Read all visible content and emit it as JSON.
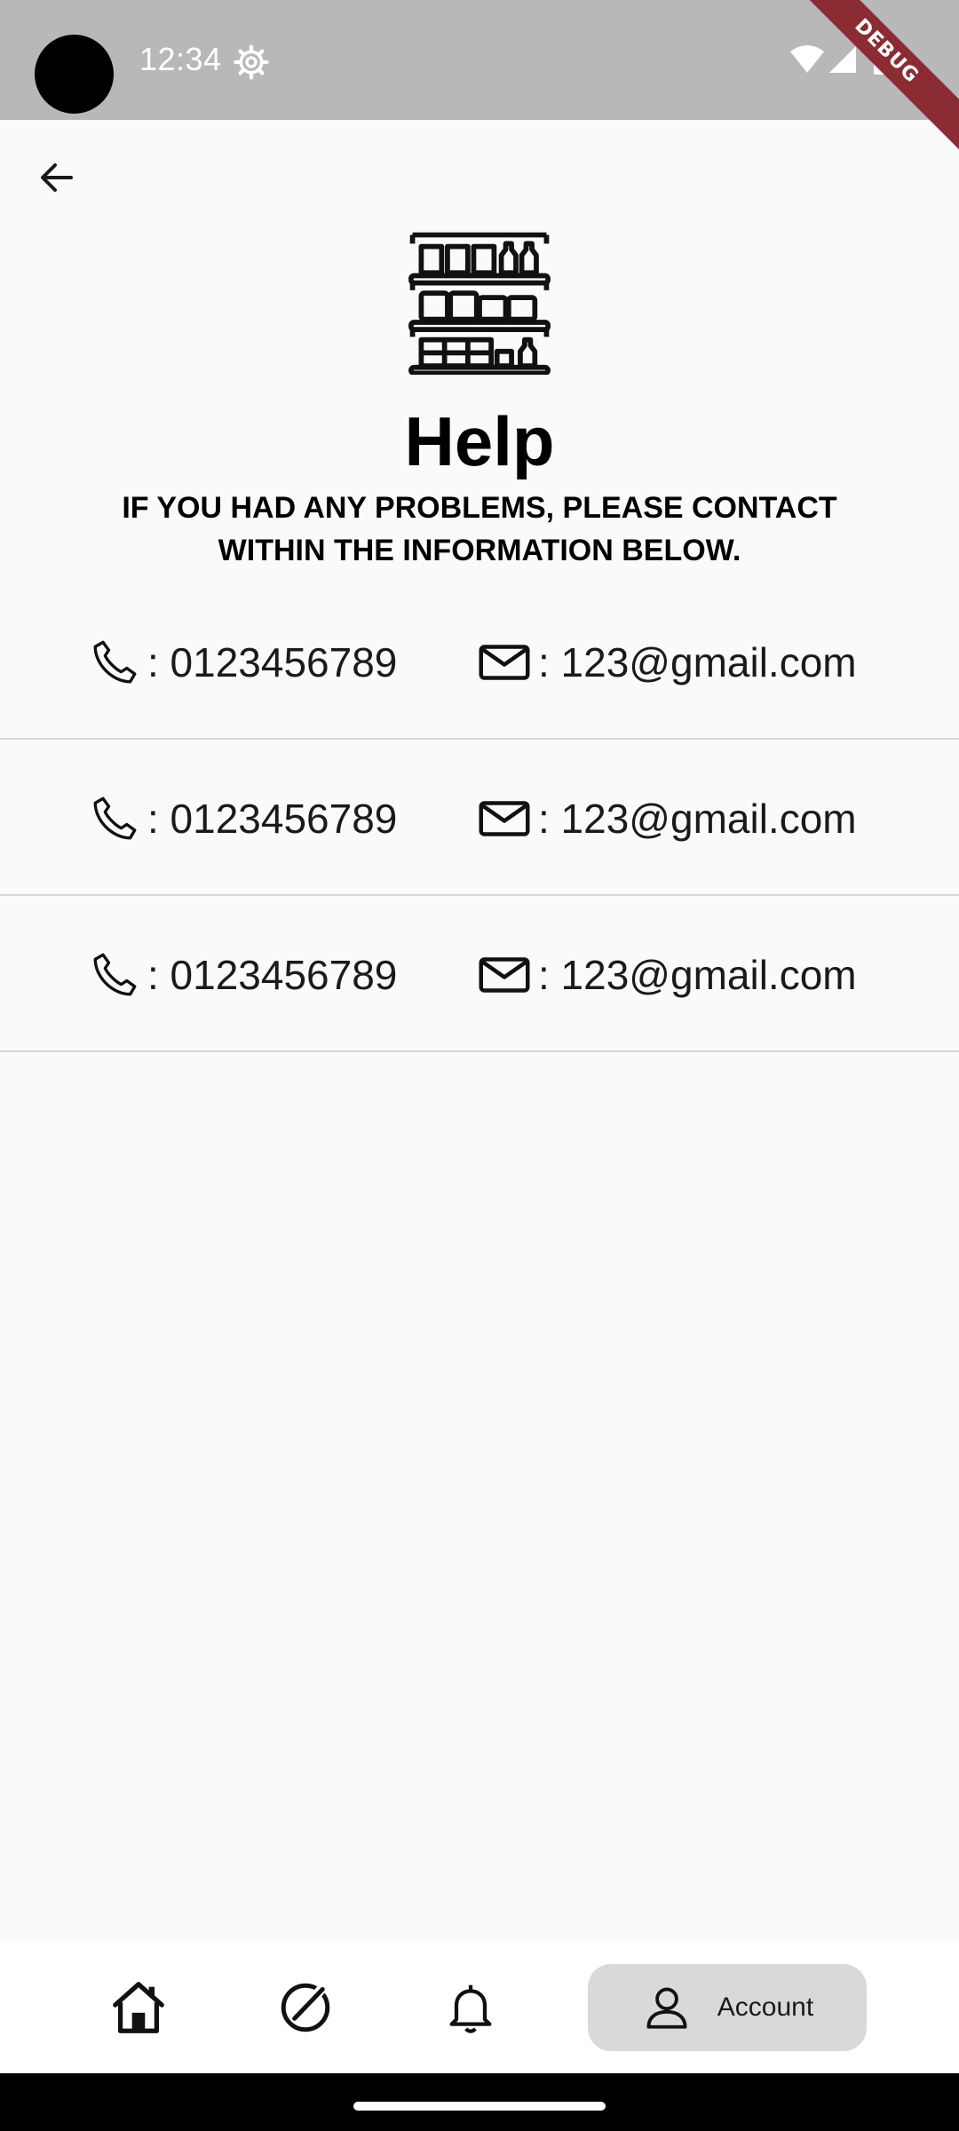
{
  "status_bar": {
    "time": "12:34",
    "debug_label": "DEBUG",
    "icons": [
      "settings-icon",
      "wifi-icon",
      "signal-icon",
      "battery-icon"
    ]
  },
  "header": {
    "back_icon": "arrow-back-icon",
    "logo_icon": "store-shelves-icon",
    "title": "Help",
    "subtitle": "IF YOU HAD ANY PROBLEMS, PLEASE CONTACT WITHIN THE INFORMATION BELOW."
  },
  "contacts": [
    {
      "phone": ": 0123456789",
      "email": ": 123@gmail.com"
    },
    {
      "phone": ": 0123456789",
      "email": ": 123@gmail.com"
    },
    {
      "phone": ": 0123456789",
      "email": ": 123@gmail.com"
    }
  ],
  "bottom_nav": {
    "items": [
      {
        "icon": "home-icon"
      },
      {
        "icon": "explore-icon"
      },
      {
        "icon": "bell-icon"
      },
      {
        "icon": "person-icon",
        "label": "Account",
        "selected": true
      }
    ]
  },
  "colors": {
    "status_bar": "#b8b8b8",
    "background": "#fafafa",
    "nav_selected": "#d9d9d9",
    "debug_ribbon": "#8b2c33",
    "divider": "#d6d6d6"
  }
}
